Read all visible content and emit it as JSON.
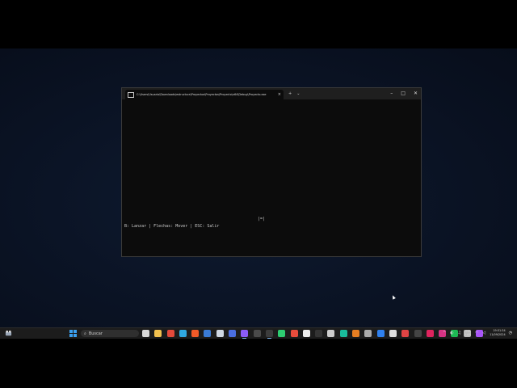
{
  "window": {
    "tab_title": "C:\\Users\\Usuario\\Downloads\\estructura\\Proyectos\\Proyectos\\Proyecto\\x64\\Debug\\Proyecto.exe",
    "new_tab_glyph": "+",
    "dropdown_glyph": "⌄",
    "close_tab_glyph": "×",
    "minimize_glyph": "–",
    "maximize_glyph": "□",
    "close_glyph": "✕"
  },
  "console": {
    "player_sprite": "|=|",
    "help_text": "B: Lanzar | Flechas: Mover | ESC: Salir"
  },
  "taskbar": {
    "search_label": "Buscar",
    "search_glyph": "⌕",
    "apps": [
      {
        "name": "task-view",
        "color": "#d8d8d8"
      },
      {
        "name": "file-explorer",
        "color": "#f2c14e"
      },
      {
        "name": "chrome",
        "color": "#e24a3b"
      },
      {
        "name": "edge",
        "color": "#2fa8e0"
      },
      {
        "name": "brave",
        "color": "#f05a28"
      },
      {
        "name": "app-cube",
        "color": "#3a7bd5"
      },
      {
        "name": "app-hex",
        "color": "#cfd8e3"
      },
      {
        "name": "app-blue",
        "color": "#4a6ee0"
      },
      {
        "name": "visual-studio",
        "color": "#8b5cf6"
      },
      {
        "name": "app-terminal-dark",
        "color": "#4a4a4a"
      },
      {
        "name": "terminal",
        "color": "#3c3c3c"
      },
      {
        "name": "app-green",
        "color": "#2ecc71"
      },
      {
        "name": "app-red",
        "color": "#e74c3c"
      },
      {
        "name": "app-white",
        "color": "#eeeeee"
      },
      {
        "name": "app-black",
        "color": "#333333"
      },
      {
        "name": "app-g",
        "color": "#cccccc"
      },
      {
        "name": "app-teal",
        "color": "#1abc9c"
      },
      {
        "name": "app-orange",
        "color": "#e67e22"
      },
      {
        "name": "app-gray",
        "color": "#aaaaaa"
      },
      {
        "name": "vscode",
        "color": "#2f80ed"
      },
      {
        "name": "app-snip",
        "color": "#dddddd"
      },
      {
        "name": "app-red2",
        "color": "#e04444"
      },
      {
        "name": "app-dark",
        "color": "#444444"
      },
      {
        "name": "app-jetbrains",
        "color": "#e0245e"
      },
      {
        "name": "app-pink",
        "color": "#d63384"
      },
      {
        "name": "spotify",
        "color": "#1db954"
      },
      {
        "name": "app-lightgray",
        "color": "#bbbbbb"
      },
      {
        "name": "app-purple",
        "color": "#a855f7"
      }
    ],
    "tray_chevron": "^",
    "tray_glyphs": [
      "◐",
      "♫"
    ],
    "lang_line1": "ESP",
    "lang_line2": "LAA",
    "clock_time": "19:51:34",
    "clock_date": "11/09/2024",
    "wifi_glyph": "◠",
    "volume_glyph": "◁",
    "bell_glyph": "◔"
  }
}
